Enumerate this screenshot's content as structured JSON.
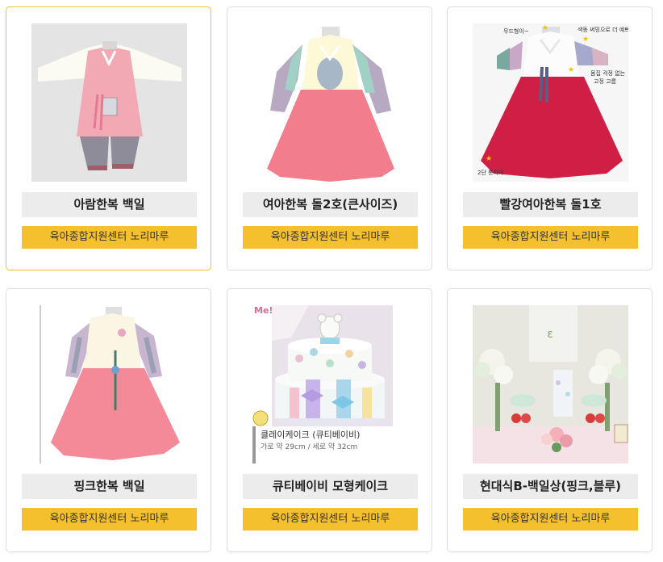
{
  "products": [
    {
      "title": "아람한복 백일",
      "center": "육아종합지원센터 노리마루",
      "image_icon": "hanbok-pink-boy-image"
    },
    {
      "title": "여아한복 돌2호(큰사이즈)",
      "center": "육아종합지원센터 노리마루",
      "image_icon": "hanbok-pink-girl-image"
    },
    {
      "title": "빨강여아한복 돌1호",
      "center": "육아종합지원센터 노리마루",
      "image_icon": "hanbok-red-girl-image"
    },
    {
      "title": "핑크한복 백일",
      "center": "육아종합지원센터 노리마루",
      "image_icon": "hanbok-pink-baby-image"
    },
    {
      "title": "큐티베이비 모형케이크",
      "center": "육아종합지원센터 노리마루",
      "image_icon": "clay-cake-image"
    },
    {
      "title": "현대식B-백일상(핑크,블루)",
      "center": "육아종합지원센터 노리마루",
      "image_icon": "celebration-table-image"
    }
  ],
  "image_text": {
    "red_hanbok_notes": [
      "무드형이~",
      "색동 써밍으로 더 예쁘게~",
      "몸집 걱정 없는",
      "고정 고름",
      "2단 통치마"
    ],
    "cake_caption": "클레이케이크 (큐티베이비)",
    "cake_size": "가로 약 29cm / 세로 약 32cm",
    "cake_sign": "Me!"
  },
  "colors": {
    "accent_yellow": "#f5c02e",
    "selected_border": "#f1c232",
    "title_bg": "#ececec"
  }
}
